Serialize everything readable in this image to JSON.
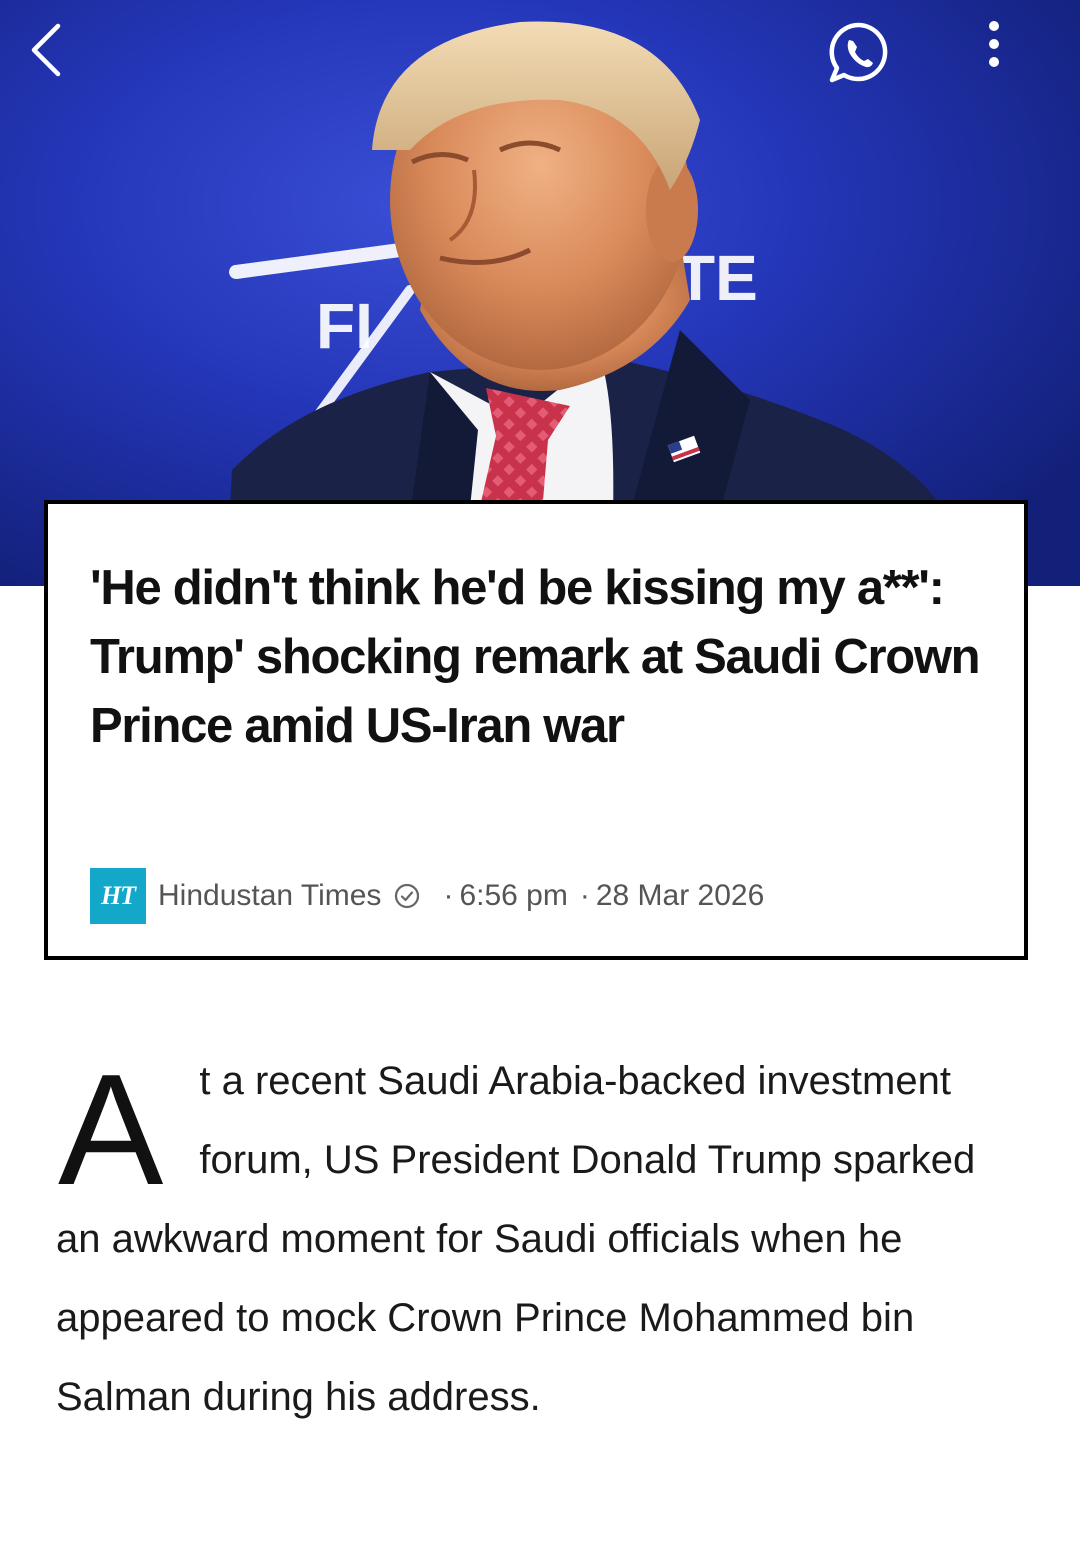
{
  "hero": {
    "image_alt": "Donald Trump in suit with red tie on blue stage backdrop",
    "backdrop_text_left": "FI",
    "backdrop_text_right": "TE"
  },
  "topbar": {
    "back_icon": "chevron-left-icon",
    "share_icon": "whatsapp-icon",
    "menu_icon": "more-vertical-icon"
  },
  "article": {
    "headline": "'He didn't think he'd be kissing my a**': Trump' shocking remark at Saudi Crown Prince amid US-Iran war",
    "publisher": {
      "logo_text": "HT",
      "name": "Hindustan Times",
      "verified_icon": "verified-check-icon"
    },
    "time": "6:56 pm",
    "date": "28 Mar 2026",
    "separator": "·",
    "drop_cap": "A",
    "body": "t a recent Saudi Arabia-backed investment forum, US President Donald Trump sparked an awkward moment for Saudi officials when he appeared to mock Crown Prince Mohammed bin Salman during his address."
  },
  "colors": {
    "hero_blue": "#2436b8",
    "ht_brand": "#13a7c9",
    "headline": "#111111",
    "meta": "#555555"
  }
}
